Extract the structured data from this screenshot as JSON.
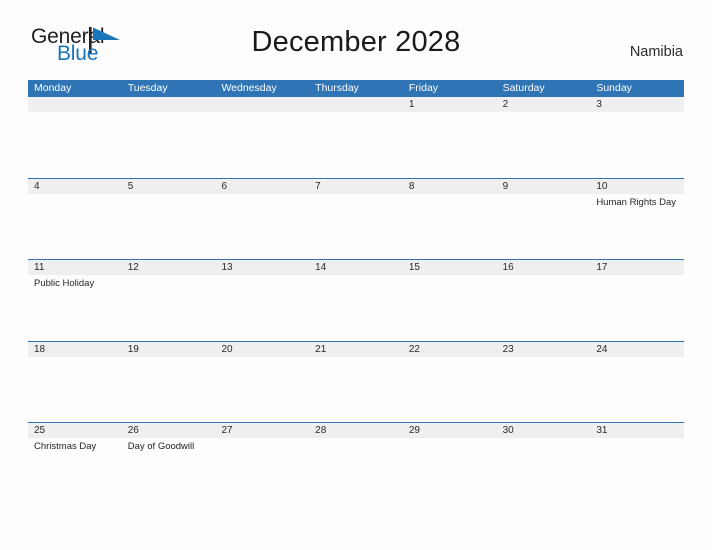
{
  "branding": {
    "logo_text_primary": "General",
    "logo_text_secondary": "Blue",
    "logo_icon": "flag-triangle-icon",
    "accent_color": "#2f74b5",
    "logo_blue": "#1b75bb",
    "band_color": "#efefef"
  },
  "header": {
    "title": "December 2028",
    "region": "Namibia"
  },
  "calendar": {
    "weekday_headers": [
      "Monday",
      "Tuesday",
      "Wednesday",
      "Thursday",
      "Friday",
      "Saturday",
      "Sunday"
    ],
    "weeks": [
      {
        "days": [
          {
            "number": "",
            "event": ""
          },
          {
            "number": "",
            "event": ""
          },
          {
            "number": "",
            "event": ""
          },
          {
            "number": "",
            "event": ""
          },
          {
            "number": "1",
            "event": ""
          },
          {
            "number": "2",
            "event": ""
          },
          {
            "number": "3",
            "event": ""
          }
        ]
      },
      {
        "days": [
          {
            "number": "4",
            "event": ""
          },
          {
            "number": "5",
            "event": ""
          },
          {
            "number": "6",
            "event": ""
          },
          {
            "number": "7",
            "event": ""
          },
          {
            "number": "8",
            "event": ""
          },
          {
            "number": "9",
            "event": ""
          },
          {
            "number": "10",
            "event": "Human Rights Day"
          }
        ]
      },
      {
        "days": [
          {
            "number": "11",
            "event": "Public Holiday"
          },
          {
            "number": "12",
            "event": ""
          },
          {
            "number": "13",
            "event": ""
          },
          {
            "number": "14",
            "event": ""
          },
          {
            "number": "15",
            "event": ""
          },
          {
            "number": "16",
            "event": ""
          },
          {
            "number": "17",
            "event": ""
          }
        ]
      },
      {
        "days": [
          {
            "number": "18",
            "event": ""
          },
          {
            "number": "19",
            "event": ""
          },
          {
            "number": "20",
            "event": ""
          },
          {
            "number": "21",
            "event": ""
          },
          {
            "number": "22",
            "event": ""
          },
          {
            "number": "23",
            "event": ""
          },
          {
            "number": "24",
            "event": ""
          }
        ]
      },
      {
        "days": [
          {
            "number": "25",
            "event": "Christmas Day"
          },
          {
            "number": "26",
            "event": "Day of Goodwill"
          },
          {
            "number": "27",
            "event": ""
          },
          {
            "number": "28",
            "event": ""
          },
          {
            "number": "29",
            "event": ""
          },
          {
            "number": "30",
            "event": ""
          },
          {
            "number": "31",
            "event": ""
          }
        ]
      }
    ]
  }
}
